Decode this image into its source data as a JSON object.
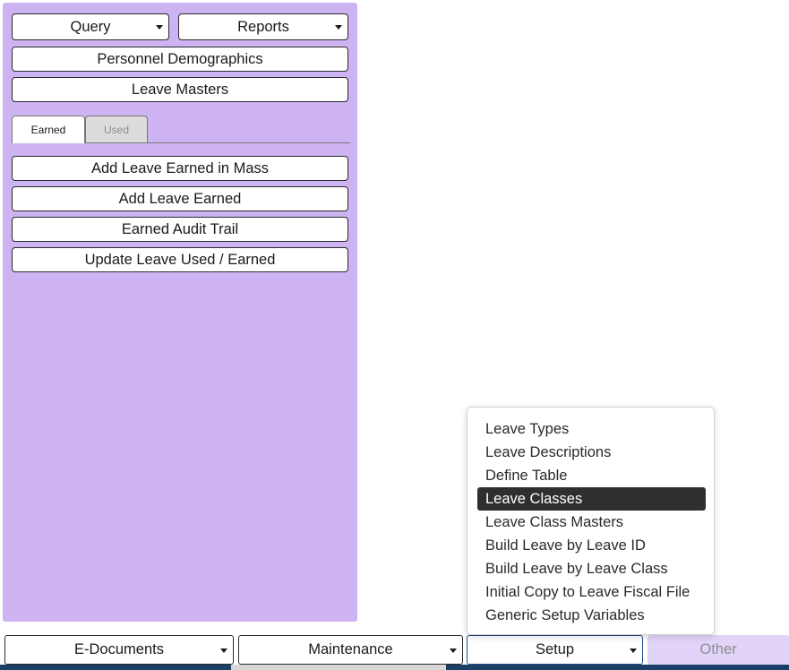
{
  "sidebar": {
    "query_label": "Query",
    "reports_label": "Reports",
    "personnel_demographics_label": "Personnel Demographics",
    "leave_masters_label": "Leave Masters",
    "tabs": [
      {
        "label": "Earned",
        "active": true
      },
      {
        "label": "Used",
        "active": false
      }
    ],
    "actions": [
      {
        "label": "Add Leave Earned in Mass"
      },
      {
        "label": "Add Leave Earned"
      },
      {
        "label": "Earned Audit Trail"
      },
      {
        "label": "Update Leave Used / Earned"
      }
    ]
  },
  "setup_menu": {
    "selected": "Leave Classes",
    "items": [
      {
        "label": "Leave Types"
      },
      {
        "label": "Leave Descriptions"
      },
      {
        "label": "Define Table"
      },
      {
        "label": "Leave Classes"
      },
      {
        "label": "Leave Class Masters"
      },
      {
        "label": "Build Leave by Leave ID"
      },
      {
        "label": "Build Leave by Leave Class"
      },
      {
        "label": "Initial Copy to Leave Fiscal File"
      },
      {
        "label": "Generic Setup Variables"
      }
    ]
  },
  "bottom_bar": {
    "e_documents_label": "E-Documents",
    "maintenance_label": "Maintenance",
    "setup_label": "Setup",
    "other_label": "Other"
  },
  "colors": {
    "sidebar_bg": "#cdb3f1",
    "selected_item_bg": "#2f2f2f",
    "setup_border": "#1f4f86",
    "other_bg": "#e2d3f8",
    "bottom_strip": "#1b3f66"
  },
  "icons": {
    "dropdown": "caret-down-icon"
  }
}
